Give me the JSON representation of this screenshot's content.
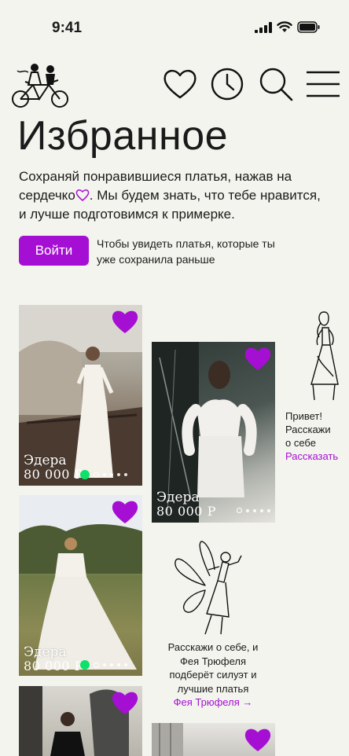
{
  "status": {
    "time": "9:41"
  },
  "header": {
    "icons": [
      "heart-icon",
      "history-clock-icon",
      "search-icon",
      "menu-icon"
    ]
  },
  "page": {
    "title": "Избранное",
    "intro_part1": "Сохраняй понравившиеся платья, нажав на сердечко",
    "intro_part2": ". Мы будем знать, что тебе нравится, и лучше подготовимся к примерке.",
    "login_button": "Войти",
    "login_hint": "Чтобы увидеть платья, которые ты уже сохранила раньше"
  },
  "cards": [
    {
      "name": "Эдера",
      "price": "80 000 Р"
    },
    {
      "name": "Эдера",
      "price": "80 000 Р"
    },
    {
      "name": "Эдера",
      "price": "80 000 Р"
    }
  ],
  "questionnaire": {
    "text_line1": "Привет!",
    "text_line2": "Расскажи",
    "text_line3": "о себе",
    "link": "Рассказать"
  },
  "fairy": {
    "text": "Расскажи о себе, и Фея Трюфеля подберёт силуэт и лучшие платья",
    "link": "Фея Трюфеля →"
  },
  "colors": {
    "accent": "#a50fd3",
    "background": "#f4f4ef",
    "indicator": "#10e06a"
  }
}
